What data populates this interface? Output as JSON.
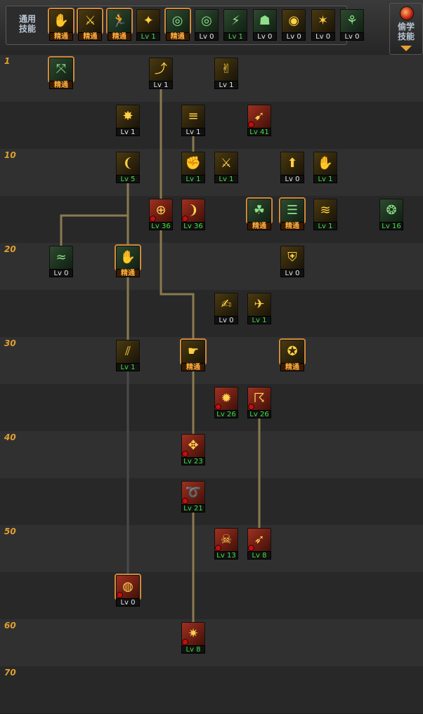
{
  "topbar": {
    "common_label": "通用\n技能",
    "secret_label": "偷学\n技能",
    "common_skills": [
      {
        "glyph": "✋",
        "style": "gold",
        "tag": "精通",
        "tag_style": "orange",
        "master": true
      },
      {
        "glyph": "⚔",
        "style": "gold",
        "tag": "精通",
        "tag_style": "orange",
        "master": true
      },
      {
        "glyph": "🏃",
        "style": "green",
        "tag": "精通",
        "tag_style": "orange",
        "master": true
      },
      {
        "glyph": "✦",
        "style": "gold",
        "tag": "Lv 1",
        "tag_style": "green",
        "master": false
      },
      {
        "glyph": "◎",
        "style": "green",
        "tag": "精通",
        "tag_style": "orange",
        "master": true
      },
      {
        "glyph": "◎",
        "style": "green",
        "tag": "Lv 0",
        "tag_style": "white",
        "master": false
      },
      {
        "glyph": "⚡",
        "style": "green",
        "tag": "Lv 1",
        "tag_style": "green",
        "master": false
      },
      {
        "glyph": "☗",
        "style": "green",
        "tag": "Lv 0",
        "tag_style": "white",
        "master": false
      },
      {
        "glyph": "◉",
        "style": "gold",
        "tag": "Lv 0",
        "tag_style": "white",
        "master": false
      },
      {
        "glyph": "✶",
        "style": "gold",
        "tag": "Lv 0",
        "tag_style": "white",
        "master": false
      },
      {
        "glyph": "⚘",
        "style": "green",
        "tag": "Lv 0",
        "tag_style": "white",
        "master": false
      }
    ]
  },
  "levels": [
    "1",
    "",
    "10",
    "",
    "20",
    "",
    "30",
    "",
    "40",
    "",
    "50",
    "",
    "60",
    "70"
  ],
  "skills": [
    {
      "row": 0,
      "col": 0,
      "glyph": "⤧",
      "style": "green",
      "tag": "精通",
      "tag_style": "orange",
      "master": true
    },
    {
      "row": 0,
      "col": 2,
      "glyph": "⤴",
      "style": "gold",
      "tag": "Lv 1",
      "tag_style": "white"
    },
    {
      "row": 0,
      "col": 4,
      "glyph": "✌",
      "style": "gold",
      "tag": "Lv 1",
      "tag_style": "white"
    },
    {
      "row": 1,
      "col": 1,
      "glyph": "✸",
      "style": "gold",
      "tag": "Lv 1",
      "tag_style": "white"
    },
    {
      "row": 1,
      "col": 3,
      "glyph": "≡",
      "style": "gold",
      "tag": "Lv 1",
      "tag_style": "white"
    },
    {
      "row": 1,
      "col": 5,
      "glyph": "➹",
      "style": "red",
      "tag": "Lv 41",
      "tag_style": "green",
      "lock": true
    },
    {
      "row": 2,
      "col": 1,
      "glyph": "❨",
      "style": "gold",
      "tag": "Lv 5",
      "tag_style": "green"
    },
    {
      "row": 2,
      "col": 3,
      "glyph": "✊",
      "style": "gold",
      "tag": "Lv 1",
      "tag_style": "green"
    },
    {
      "row": 2,
      "col": 4,
      "glyph": "⚔",
      "style": "gold",
      "tag": "Lv 1",
      "tag_style": "green"
    },
    {
      "row": 2,
      "col": 6,
      "glyph": "⬆",
      "style": "gold",
      "tag": "Lv 0",
      "tag_style": "white"
    },
    {
      "row": 2,
      "col": 7,
      "glyph": "✋",
      "style": "gold",
      "tag": "Lv 1",
      "tag_style": "green"
    },
    {
      "row": 3,
      "col": 2,
      "glyph": "⊕",
      "style": "red",
      "tag": "Lv 36",
      "tag_style": "green",
      "lock": true
    },
    {
      "row": 3,
      "col": 3,
      "glyph": "❩",
      "style": "red",
      "tag": "Lv 36",
      "tag_style": "green",
      "lock": true
    },
    {
      "row": 3,
      "col": 5,
      "glyph": "☘",
      "style": "green",
      "tag": "精通",
      "tag_style": "orange",
      "master": true
    },
    {
      "row": 3,
      "col": 6,
      "glyph": "☰",
      "style": "green",
      "tag": "精通",
      "tag_style": "orange",
      "master": true
    },
    {
      "row": 3,
      "col": 7,
      "glyph": "≋",
      "style": "gold",
      "tag": "Lv 1",
      "tag_style": "green"
    },
    {
      "row": 3,
      "col": 9,
      "glyph": "❂",
      "style": "green",
      "tag": "Lv 16",
      "tag_style": "green"
    },
    {
      "row": 4,
      "col": 0,
      "glyph": "≈",
      "style": "green",
      "tag": "Lv 0",
      "tag_style": "white"
    },
    {
      "row": 4,
      "col": 1,
      "glyph": "✋",
      "style": "green",
      "tag": "精通",
      "tag_style": "orange",
      "master": true
    },
    {
      "row": 4,
      "col": 6,
      "glyph": "⛨",
      "style": "gold",
      "tag": "Lv 0",
      "tag_style": "white"
    },
    {
      "row": 5,
      "col": 4,
      "glyph": "✍",
      "style": "gold",
      "tag": "Lv 0",
      "tag_style": "white"
    },
    {
      "row": 5,
      "col": 5,
      "glyph": "✈",
      "style": "gold",
      "tag": "Lv 1",
      "tag_style": "green"
    },
    {
      "row": 6,
      "col": 1,
      "glyph": "⫽",
      "style": "gold",
      "tag": "Lv 1",
      "tag_style": "green"
    },
    {
      "row": 6,
      "col": 3,
      "glyph": "☛",
      "style": "gold",
      "tag": "精通",
      "tag_style": "orange",
      "master": true
    },
    {
      "row": 6,
      "col": 6,
      "glyph": "✪",
      "style": "gold",
      "tag": "精通",
      "tag_style": "orange",
      "master": true
    },
    {
      "row": 7,
      "col": 4,
      "glyph": "✹",
      "style": "red",
      "tag": "Lv 26",
      "tag_style": "green",
      "lock": true
    },
    {
      "row": 7,
      "col": 5,
      "glyph": "☈",
      "style": "red",
      "tag": "Lv 26",
      "tag_style": "green",
      "lock": true
    },
    {
      "row": 8,
      "col": 3,
      "glyph": "✥",
      "style": "red",
      "tag": "Lv 23",
      "tag_style": "green",
      "lock": true
    },
    {
      "row": 9,
      "col": 3,
      "glyph": "➰",
      "style": "red",
      "tag": "Lv 21",
      "tag_style": "green",
      "lock": true
    },
    {
      "row": 10,
      "col": 4,
      "glyph": "☠",
      "style": "red",
      "tag": "Lv 13",
      "tag_style": "green",
      "lock": true
    },
    {
      "row": 10,
      "col": 5,
      "glyph": "➶",
      "style": "red",
      "tag": "Lv 8",
      "tag_style": "green",
      "lock": true
    },
    {
      "row": 11,
      "col": 1,
      "glyph": "◍",
      "style": "red",
      "tag": "Lv 0",
      "tag_style": "white",
      "lock": true,
      "master": true
    },
    {
      "row": 12,
      "col": 3,
      "glyph": "✷",
      "style": "red",
      "tag": "Lv 8",
      "tag_style": "green",
      "lock": true
    }
  ],
  "colors": {
    "level_label": "#e0a030",
    "line": "#8a7a50",
    "line_dim": "#4a4a4a"
  }
}
